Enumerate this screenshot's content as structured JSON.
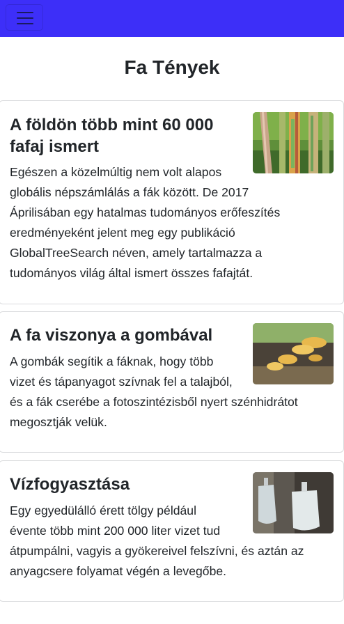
{
  "navbar": {
    "color": "#3d2ff8",
    "toggle_icon": "hamburger-menu-icon"
  },
  "page": {
    "title": "Fa Tények"
  },
  "cards": [
    {
      "title_line1": "A földön több mint 60 000",
      "title_line2": "fafaj ismert",
      "text_lines": [
        "Egészen a közelmúltig nem volt alapos",
        "globális népszámlálás a fák között. De 2017",
        "Áprilisában egy hatalmas tudományos erőfeszítés",
        "eredményeként jelent meg egy publikáció",
        "GlobalTreeSearch néven, amely tartalmazza a",
        "tudományos világ által ismert összes fafajtát."
      ],
      "image": "rainbow-eucalyptus-trunks-image"
    },
    {
      "title_line1": "A fa viszonya a gombával",
      "text_lines": [
        "A gombák segítik a fáknak, hogy több",
        "vizet és tápanyagot szívnak fel a talajból,",
        "és a fák cserébe a fotoszintézisből nyert szénhidrátot",
        "megosztják velük."
      ],
      "image": "shelf-fungus-on-log-image"
    },
    {
      "title_line1": "Vízfogyasztása",
      "text_lines": [
        "Egy egyedülálló érett tölgy például",
        "évente több mint 200 000 liter vizet tud",
        "átpumpálni, vagyis a gyökereivel felszívni, és aztán az",
        "anyagcsere folyamat végén a levegőbe."
      ],
      "image": "water-bags-on-tree-image"
    }
  ]
}
